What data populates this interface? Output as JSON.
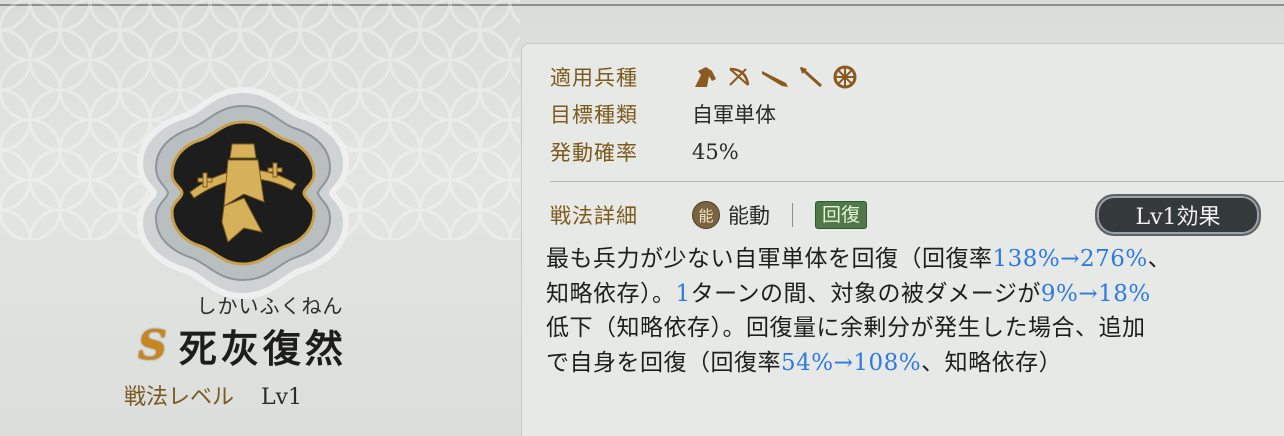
{
  "skill": {
    "reading": "しかいふくねん",
    "grade": "S",
    "name": "死灰復然",
    "level_label": "戦法レベル",
    "level_value": "Lv1"
  },
  "info": {
    "troop_label": "適用兵種",
    "troop_icons": [
      "cavalry-icon",
      "bow-icon",
      "gun-icon",
      "spear-icon",
      "wheel-icon"
    ],
    "target_label": "目標種類",
    "target_value": "自軍単体",
    "rate_label": "発動確率",
    "rate_value": "45%"
  },
  "detail": {
    "label": "戦法詳細",
    "active_badge": "能",
    "active_text": "能動",
    "tag": "回復",
    "level_button": "Lv1効果"
  },
  "description": {
    "p1": "最も兵力が少ない自軍単体を回復（回復率",
    "v1": "138%→276%",
    "p2": "、",
    "p3": "知略依存）。",
    "v2": "1",
    "p4": "ターンの間、対象の被ダメージが",
    "v3": "9%→18%",
    "p5": "低下（知略依存）。回復量に余剰分が発生した場合、追加",
    "p6": "で自身を回復（回復率",
    "v4": "54%→108%",
    "p7": "、知略依存）"
  },
  "colors": {
    "gold": "#c8861e",
    "label": "#7d5a1e",
    "highlight": "#2e7ae0",
    "tag": "#4f7a47"
  }
}
